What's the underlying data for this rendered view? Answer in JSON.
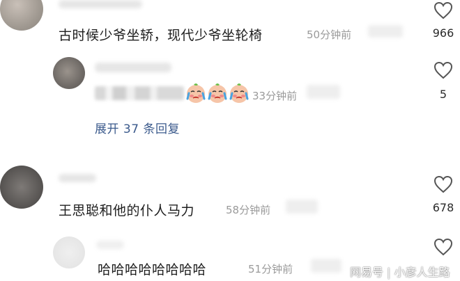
{
  "comments": [
    {
      "text": "古时候少爷坐轿，现代少爷坐轮椅",
      "time": "50分钟前",
      "likes": "966"
    },
    {
      "text": "",
      "time": "33分钟前",
      "likes": "5",
      "expand_label": "展开 37 条回复",
      "emoji": "crying-face"
    },
    {
      "text": "王思聪和他的仆人马力",
      "time": "58分钟前",
      "likes": "678"
    },
    {
      "text": "哈哈哈哈哈哈哈哈",
      "time": "51分钟前",
      "likes": ""
    }
  ],
  "watermark": {
    "text": "网易号 | 小彦人生路"
  },
  "icons": {
    "like": "heart-outline-icon"
  },
  "colors": {
    "expand_link": "#3b5a8c",
    "time_text": "#9a9a9a"
  }
}
